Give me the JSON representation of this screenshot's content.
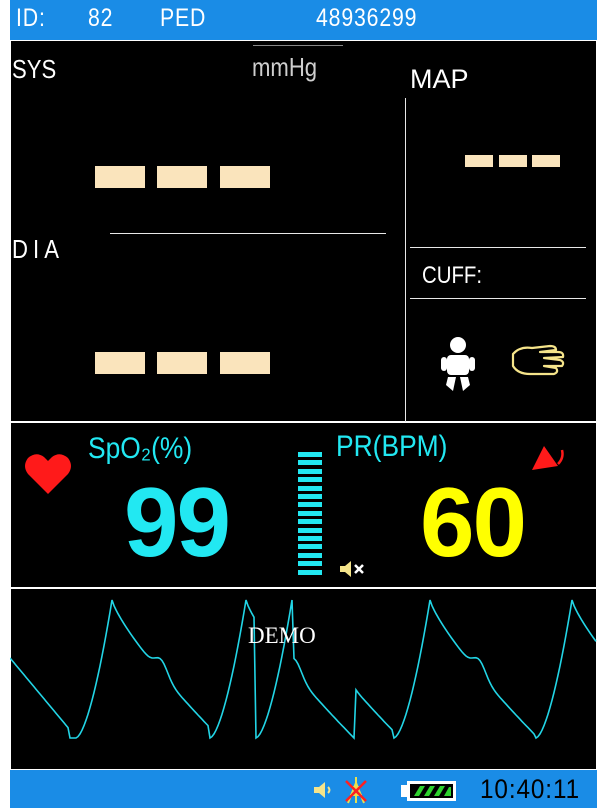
{
  "header": {
    "id_label": "ID:",
    "id_value": "82",
    "patient_type": "PED",
    "serial": "48936299"
  },
  "nibp": {
    "sys_label": "SYS",
    "unit": "mmHg",
    "map_label": "MAP",
    "dia_label": "DIA",
    "cuff_label": "CUFF:"
  },
  "spo2": {
    "label": "SpO₂(%)",
    "value": "99"
  },
  "pr": {
    "label": "PR(BPM)",
    "value": "60"
  },
  "waveform": {
    "overlay": "DEMO"
  },
  "status": {
    "time": "10:40:11"
  },
  "colors": {
    "header_bar": "#1a8ce6",
    "spo2": "#22e8f2",
    "pr": "#ffff00",
    "heart": "#ff1a1a",
    "placeholder_dash": "#fae4bc"
  },
  "icons": {
    "heart": "heart-icon",
    "alarm": "alarm-bell-icon",
    "mute": "speaker-muted-icon",
    "sound": "speaker-icon",
    "network": "network-off-icon",
    "battery": "battery-icon",
    "patient": "pediatric-patient-icon",
    "cuff": "hand-cuff-icon"
  }
}
